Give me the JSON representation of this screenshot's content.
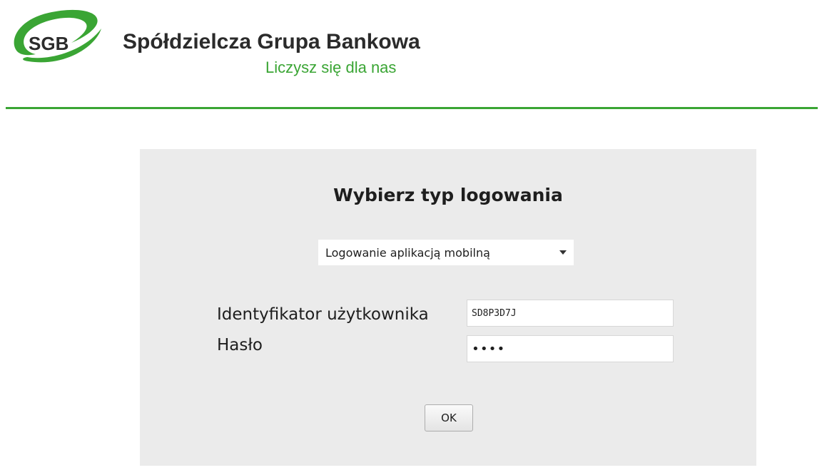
{
  "brand": {
    "logo_text": "SGB",
    "name": "Spółdzielcza Grupa Bankowa",
    "slogan": "Liczysz się dla nas",
    "accent_color": "#3aa534"
  },
  "login": {
    "title": "Wybierz typ logowania",
    "login_type": {
      "selected": "Logowanie aplikacją mobilną",
      "icon": "chevron-down-icon"
    },
    "user_id": {
      "label": "Identyfikator użytkownika",
      "value": "SD8P3D7J"
    },
    "password": {
      "label": "Hasło",
      "value": "1234"
    },
    "ok_label": "OK"
  }
}
